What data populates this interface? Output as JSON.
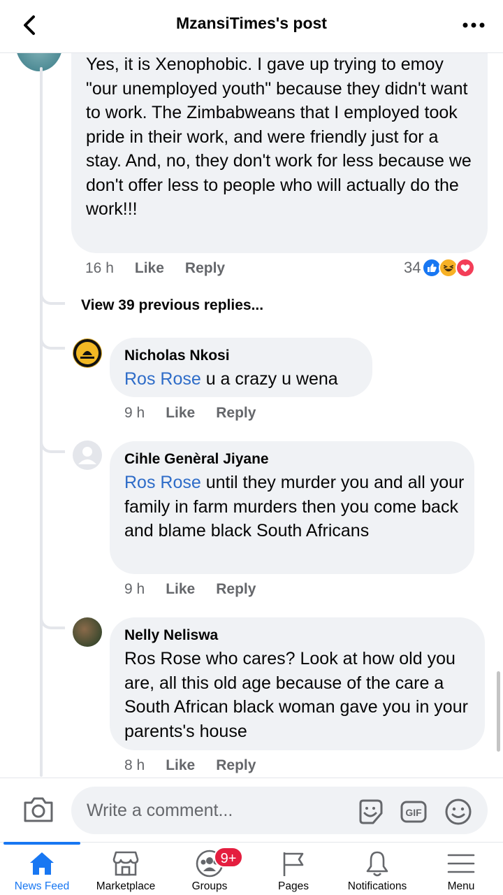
{
  "header": {
    "title": "MzansiTimes's post"
  },
  "top_comment": {
    "text": "Yes, it is Xenophobic. I gave up trying to emoy \"our unemployed youth\" because they didn't want to work. The Zimbabweans that I employed took pride in their work, and were friendly just for a stay. And, no, they don't work for less because we don't offer less to people who will actually do the work!!!",
    "time": "16 h",
    "like": "Like",
    "reply": "Reply",
    "reaction_count": "34"
  },
  "view_previous": "View 39 previous replies...",
  "replies": [
    {
      "author": "Nicholas Nkosi",
      "mention": "Ros Rose",
      "text": " u a crazy u wena",
      "time": "9 h",
      "like": "Like",
      "reply": "Reply"
    },
    {
      "author": "Cihle Genèral Jiyane",
      "mention": "Ros Rose",
      "text": " until they murder you and all your family in farm murders then you come back and blame black South Africans",
      "time": "9 h",
      "like": "Like",
      "reply": "Reply"
    },
    {
      "author": "Nelly Neliswa",
      "text": "Ros Rose who cares? Look at how old you are, all this old age because of the care a South African black woman gave you in your parents's house",
      "time": "8 h",
      "like": "Like",
      "reply": "Reply"
    }
  ],
  "composer": {
    "placeholder": "Write a comment..."
  },
  "nav": [
    {
      "label": "News Feed",
      "icon": "home-icon",
      "active": true
    },
    {
      "label": "Marketplace",
      "icon": "shop-icon"
    },
    {
      "label": "Groups",
      "icon": "groups-icon",
      "badge": "9+"
    },
    {
      "label": "Pages",
      "icon": "flag-icon"
    },
    {
      "label": "Notifications",
      "icon": "bell-icon"
    },
    {
      "label": "Menu",
      "icon": "menu-icon"
    }
  ],
  "colors": {
    "accent": "#1877f2",
    "mention": "#2e6cc8",
    "badge": "#e41e3f",
    "bubble": "#f0f2f5",
    "muted": "#65676b"
  }
}
